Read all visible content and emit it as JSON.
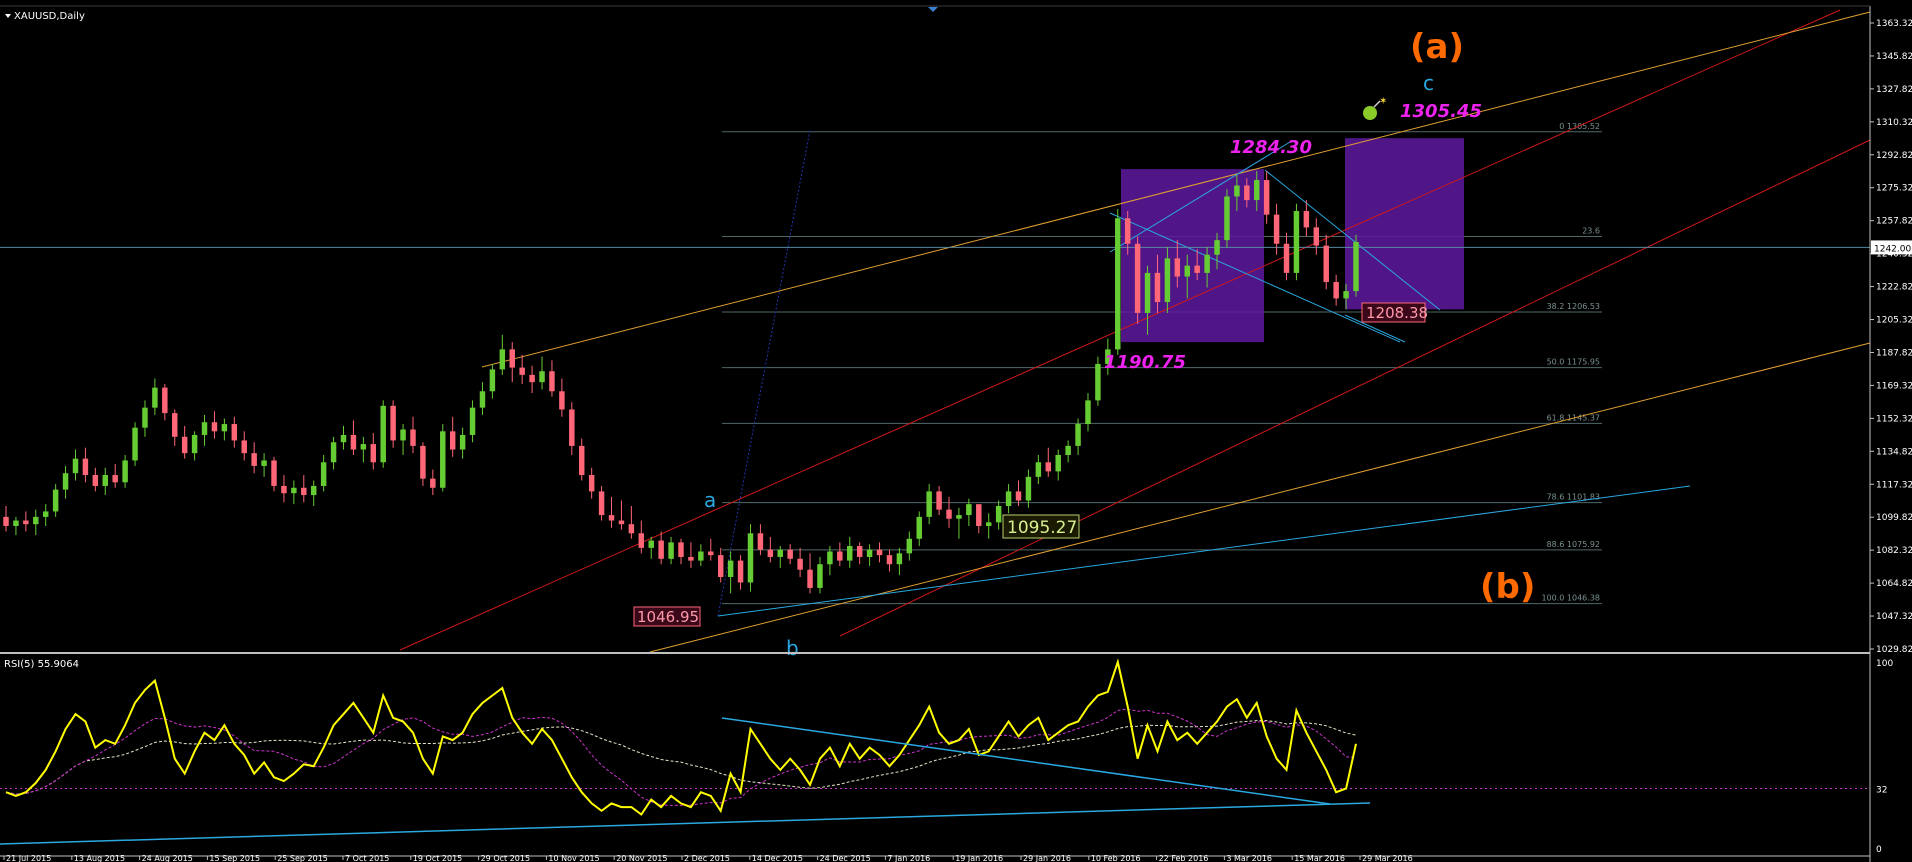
{
  "window": {
    "title": "XAUUSD,Daily"
  },
  "colors": {
    "background": "#000000",
    "grid": "#2a3a3a",
    "axis_text": "#ffffff",
    "bull_candle": "#66cc33",
    "bear_candle": "#ff6677",
    "rsi_line": "#ffff00",
    "rsi_ma_fast": "#cc33cc",
    "rsi_ma_slow": "#e6e6c8",
    "channel_red": "#d01818",
    "channel_orange": "#e0a030",
    "trend_blue": "#2aa8e0",
    "box_purple": "#5e1aa0",
    "magenta_label": "#ee22ee",
    "orange_label": "#ff6a00",
    "fib_line": "#506868"
  },
  "price_axis": {
    "ticks": [
      "1363.32",
      "1345.82",
      "1327.82",
      "1310.32",
      "1292.82",
      "1275.32",
      "1257.82",
      "1240.32",
      "1222.82",
      "1205.32",
      "1187.82",
      "1169.32",
      "1152.32",
      "1134.82",
      "1117.32",
      "1099.82",
      "1082.32",
      "1064.82",
      "1047.32",
      "1029.82"
    ],
    "current_price": "1242.00"
  },
  "fib_levels": [
    {
      "label": "0 1305.52",
      "price": 1305.52
    },
    {
      "label": "23.6",
      "price": 1248.0
    },
    {
      "label": "38.2 1206.53",
      "price": 1206.53
    },
    {
      "label": "50.0 1175.95",
      "price": 1175.95
    },
    {
      "label": "61.8 1145.37",
      "price": 1145.37
    },
    {
      "label": "78.6 1101.83",
      "price": 1101.83
    },
    {
      "label": "88.6 1075.92",
      "price": 1075.92
    },
    {
      "label": "100.0 1046.38",
      "price": 1046.38
    }
  ],
  "annotations": {
    "wave_a_big": "(a)",
    "wave_b_big": "(b)",
    "wave_c_small": "c",
    "wave_a_small": "a",
    "wave_b_small": "b",
    "target": "1305.45",
    "high": "1284.30",
    "low_feb": "1190.75",
    "support": "1208.38",
    "low_dec": "1046.95",
    "pivot": "1095.27"
  },
  "rsi": {
    "title": "RSI(5) 55.9064",
    "ticks": [
      "100",
      "32",
      "0"
    ],
    "level_value": 32
  },
  "time_axis": {
    "labels": [
      "21 Jul 2015",
      "13 Aug 2015",
      "24 Aug 2015",
      "15 Sep 2015",
      "25 Sep 2015",
      "7 Oct 2015",
      "19 Oct 2015",
      "29 Oct 2015",
      "10 Nov 2015",
      "20 Nov 2015",
      "2 Dec 2015",
      "14 Dec 2015",
      "24 Dec 2015",
      "7 Jan 2016",
      "19 Jan 2016",
      "29 Jan 2016",
      "10 Feb 2016",
      "22 Feb 2016",
      "3 Mar 2016",
      "15 Mar 2016",
      "29 Mar 2016"
    ]
  },
  "chart_data": {
    "type": "candlestick",
    "symbol": "XAUUSD",
    "timeframe": "Daily",
    "ylim": [
      1020,
      1372
    ],
    "ohlc": [
      [
        1094,
        1100,
        1086,
        1089
      ],
      [
        1089,
        1094,
        1084,
        1092
      ],
      [
        1092,
        1097,
        1086,
        1090
      ],
      [
        1090,
        1098,
        1084,
        1094
      ],
      [
        1094,
        1101,
        1089,
        1097
      ],
      [
        1097,
        1112,
        1094,
        1109
      ],
      [
        1109,
        1122,
        1104,
        1118
      ],
      [
        1118,
        1131,
        1114,
        1126
      ],
      [
        1126,
        1132,
        1113,
        1117
      ],
      [
        1117,
        1121,
        1108,
        1111
      ],
      [
        1111,
        1121,
        1106,
        1117
      ],
      [
        1117,
        1123,
        1110,
        1113
      ],
      [
        1113,
        1128,
        1110,
        1125
      ],
      [
        1125,
        1146,
        1122,
        1143
      ],
      [
        1143,
        1158,
        1138,
        1154
      ],
      [
        1154,
        1170,
        1150,
        1165
      ],
      [
        1165,
        1167,
        1147,
        1151
      ],
      [
        1151,
        1153,
        1133,
        1138
      ],
      [
        1138,
        1144,
        1126,
        1129
      ],
      [
        1129,
        1141,
        1125,
        1139
      ],
      [
        1139,
        1150,
        1133,
        1146
      ],
      [
        1146,
        1152,
        1137,
        1141
      ],
      [
        1141,
        1148,
        1136,
        1145
      ],
      [
        1145,
        1149,
        1132,
        1136
      ],
      [
        1136,
        1141,
        1125,
        1129
      ],
      [
        1129,
        1135,
        1118,
        1122
      ],
      [
        1122,
        1129,
        1116,
        1125
      ],
      [
        1125,
        1127,
        1108,
        1111
      ],
      [
        1111,
        1117,
        1102,
        1107
      ],
      [
        1107,
        1114,
        1101,
        1110
      ],
      [
        1110,
        1117,
        1102,
        1106
      ],
      [
        1106,
        1114,
        1100,
        1111
      ],
      [
        1111,
        1128,
        1108,
        1124
      ],
      [
        1124,
        1138,
        1120,
        1135
      ],
      [
        1135,
        1144,
        1131,
        1139
      ],
      [
        1139,
        1147,
        1128,
        1131
      ],
      [
        1131,
        1138,
        1124,
        1134
      ],
      [
        1134,
        1140,
        1120,
        1124
      ],
      [
        1124,
        1158,
        1121,
        1155
      ],
      [
        1155,
        1158,
        1132,
        1136
      ],
      [
        1136,
        1145,
        1128,
        1142
      ],
      [
        1142,
        1149,
        1129,
        1133
      ],
      [
        1133,
        1135,
        1111,
        1115
      ],
      [
        1115,
        1120,
        1106,
        1110
      ],
      [
        1110,
        1145,
        1108,
        1141
      ],
      [
        1141,
        1149,
        1127,
        1131
      ],
      [
        1131,
        1143,
        1126,
        1139
      ],
      [
        1139,
        1158,
        1135,
        1154
      ],
      [
        1154,
        1168,
        1150,
        1163
      ],
      [
        1163,
        1178,
        1159,
        1175
      ],
      [
        1175,
        1194,
        1172,
        1186
      ],
      [
        1186,
        1190,
        1168,
        1176
      ],
      [
        1176,
        1183,
        1167,
        1172
      ],
      [
        1172,
        1177,
        1162,
        1168
      ],
      [
        1168,
        1182,
        1164,
        1174
      ],
      [
        1174,
        1180,
        1160,
        1163
      ],
      [
        1163,
        1170,
        1149,
        1153
      ],
      [
        1153,
        1157,
        1128,
        1133
      ],
      [
        1133,
        1137,
        1114,
        1117
      ],
      [
        1117,
        1121,
        1104,
        1108
      ],
      [
        1108,
        1111,
        1092,
        1095
      ],
      [
        1095,
        1105,
        1088,
        1092
      ],
      [
        1092,
        1103,
        1087,
        1090
      ],
      [
        1090,
        1100,
        1082,
        1085
      ],
      [
        1085,
        1092,
        1074,
        1077
      ],
      [
        1077,
        1083,
        1071,
        1081
      ],
      [
        1081,
        1086,
        1068,
        1071
      ],
      [
        1071,
        1083,
        1068,
        1080
      ],
      [
        1080,
        1082,
        1068,
        1072
      ],
      [
        1072,
        1080,
        1066,
        1070
      ],
      [
        1070,
        1079,
        1067,
        1075
      ],
      [
        1075,
        1082,
        1070,
        1073
      ],
      [
        1073,
        1077,
        1058,
        1061
      ],
      [
        1061,
        1075,
        1052,
        1070
      ],
      [
        1070,
        1073,
        1054,
        1058
      ],
      [
        1058,
        1090,
        1053,
        1085
      ],
      [
        1085,
        1090,
        1073,
        1076
      ],
      [
        1076,
        1083,
        1069,
        1072
      ],
      [
        1072,
        1078,
        1066,
        1076
      ],
      [
        1076,
        1079,
        1068,
        1071
      ],
      [
        1071,
        1077,
        1061,
        1065
      ],
      [
        1065,
        1074,
        1052,
        1055
      ],
      [
        1055,
        1072,
        1052,
        1068
      ],
      [
        1068,
        1078,
        1062,
        1075
      ],
      [
        1075,
        1080,
        1067,
        1070
      ],
      [
        1070,
        1083,
        1066,
        1078
      ],
      [
        1078,
        1080,
        1068,
        1072
      ],
      [
        1072,
        1079,
        1067,
        1076
      ],
      [
        1076,
        1080,
        1069,
        1073
      ],
      [
        1073,
        1076,
        1064,
        1068
      ],
      [
        1068,
        1077,
        1062,
        1074
      ],
      [
        1074,
        1086,
        1070,
        1082
      ],
      [
        1082,
        1097,
        1078,
        1094
      ],
      [
        1094,
        1112,
        1090,
        1108
      ],
      [
        1108,
        1111,
        1095,
        1098
      ],
      [
        1098,
        1105,
        1088,
        1093
      ],
      [
        1093,
        1099,
        1082,
        1095
      ],
      [
        1095,
        1104,
        1089,
        1101
      ],
      [
        1101,
        1099,
        1085,
        1089
      ],
      [
        1089,
        1096,
        1082,
        1091
      ],
      [
        1091,
        1103,
        1087,
        1100
      ],
      [
        1100,
        1112,
        1096,
        1108
      ],
      [
        1108,
        1114,
        1100,
        1103
      ],
      [
        1103,
        1120,
        1099,
        1116
      ],
      [
        1116,
        1128,
        1112,
        1124
      ],
      [
        1124,
        1132,
        1116,
        1119
      ],
      [
        1119,
        1131,
        1114,
        1128
      ],
      [
        1128,
        1136,
        1124,
        1133
      ],
      [
        1133,
        1148,
        1128,
        1145
      ],
      [
        1145,
        1162,
        1141,
        1158
      ],
      [
        1158,
        1182,
        1155,
        1178
      ],
      [
        1178,
        1192,
        1172,
        1186
      ],
      [
        1186,
        1263,
        1183,
        1258
      ],
      [
        1258,
        1262,
        1238,
        1244
      ],
      [
        1244,
        1248,
        1200,
        1206
      ],
      [
        1206,
        1232,
        1194,
        1228
      ],
      [
        1228,
        1238,
        1206,
        1212
      ],
      [
        1212,
        1242,
        1206,
        1236
      ],
      [
        1236,
        1246,
        1220,
        1226
      ],
      [
        1226,
        1238,
        1214,
        1232
      ],
      [
        1232,
        1241,
        1224,
        1228
      ],
      [
        1228,
        1242,
        1220,
        1238
      ],
      [
        1238,
        1250,
        1230,
        1246
      ],
      [
        1246,
        1274,
        1242,
        1270
      ],
      [
        1270,
        1282,
        1262,
        1276
      ],
      [
        1276,
        1280,
        1264,
        1268
      ],
      [
        1268,
        1284,
        1262,
        1279
      ],
      [
        1279,
        1284,
        1255,
        1260
      ],
      [
        1260,
        1266,
        1238,
        1244
      ],
      [
        1244,
        1250,
        1224,
        1228
      ],
      [
        1228,
        1266,
        1224,
        1262
      ],
      [
        1262,
        1268,
        1248,
        1253
      ],
      [
        1253,
        1258,
        1238,
        1243
      ],
      [
        1243,
        1249,
        1219,
        1223
      ],
      [
        1223,
        1227,
        1210,
        1214
      ],
      [
        1214,
        1222,
        1208,
        1218
      ],
      [
        1218,
        1249,
        1215,
        1245
      ]
    ],
    "rsi_values": [
      30,
      28,
      30,
      35,
      42,
      52,
      64,
      72,
      68,
      54,
      58,
      56,
      66,
      78,
      85,
      90,
      70,
      48,
      40,
      52,
      62,
      58,
      66,
      56,
      50,
      40,
      46,
      38,
      36,
      40,
      45,
      44,
      54,
      66,
      72,
      78,
      70,
      62,
      82,
      70,
      68,
      62,
      48,
      40,
      60,
      58,
      62,
      72,
      78,
      82,
      86,
      70,
      62,
      56,
      64,
      58,
      48,
      38,
      30,
      24,
      20,
      24,
      22,
      22,
      18,
      26,
      22,
      28,
      24,
      22,
      30,
      28,
      20,
      40,
      30,
      64,
      56,
      48,
      42,
      48,
      42,
      34,
      48,
      54,
      44,
      56,
      48,
      54,
      50,
      44,
      50,
      58,
      66,
      76,
      62,
      56,
      58,
      64,
      50,
      52,
      60,
      68,
      60,
      66,
      70,
      58,
      62,
      66,
      68,
      76,
      82,
      84,
      100,
      76,
      48,
      66,
      52,
      68,
      58,
      62,
      56,
      62,
      68,
      76,
      80,
      70,
      78,
      60,
      48,
      42,
      74,
      62,
      52,
      42,
      30,
      32,
      56
    ]
  }
}
